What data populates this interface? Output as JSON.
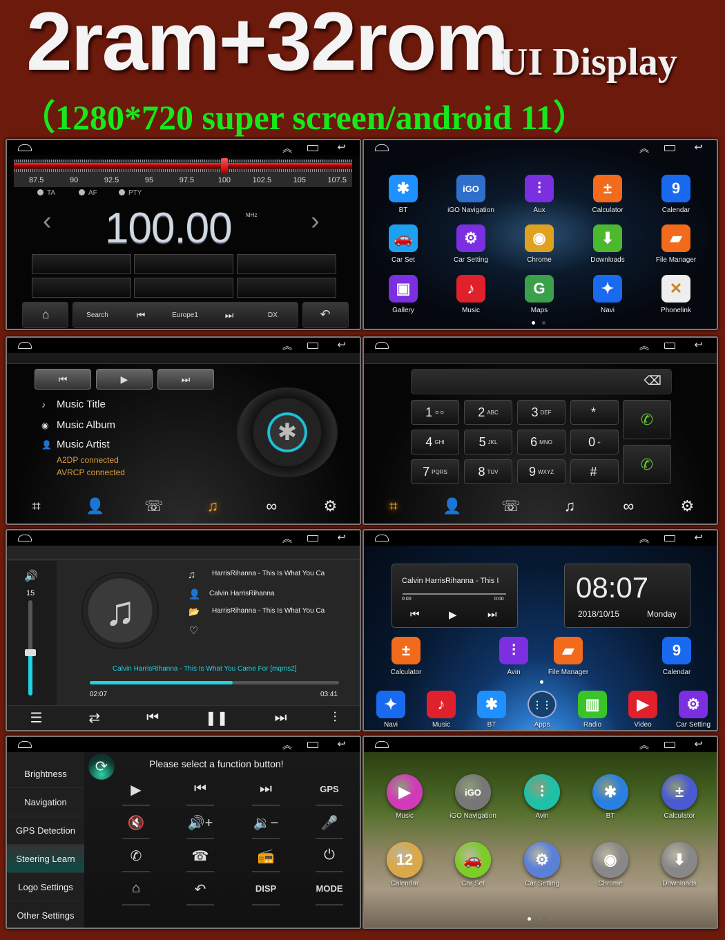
{
  "header": {
    "title": "2ram+32rom",
    "subtitle": "UI Display",
    "spec": "（1280*720 super screen/android 11）",
    "colors": {
      "background": "#6b1a0c",
      "spec_text": "#17e81a"
    }
  },
  "status_bar": {
    "home_icon": "home-outline-icon",
    "up_icon": "double-chevron-up-icon",
    "recent_icon": "recent-apps-icon",
    "back_icon": "back-arrow-icon",
    "up_glyph": "︽",
    "back_glyph": "↩"
  },
  "radio": {
    "scale_labels": [
      "87.5",
      "90",
      "92.5",
      "95",
      "97.5",
      "100",
      "102.5",
      "105",
      "107.5"
    ],
    "scale_range": [
      86,
      108.5
    ],
    "tuned": 100,
    "options": [
      "TA",
      "AF",
      "PTY"
    ],
    "frequency": "100.00",
    "unit": "MHz",
    "prev_glyph": "‹",
    "next_glyph": "›",
    "presets": [
      "",
      "",
      "",
      "",
      "",
      ""
    ],
    "toolbar": {
      "home": "⌂",
      "search": "Search",
      "prev": "⏮",
      "station": "Europe1",
      "next": "⏭",
      "dx": "DX",
      "back": "↶"
    }
  },
  "app_grid": {
    "apps": [
      {
        "name": "BT",
        "glyph": "✱",
        "color": "#1e90ff"
      },
      {
        "name": "iGO Navigation",
        "glyph": "iGO",
        "color": "#2f6fcc"
      },
      {
        "name": "Aux",
        "glyph": "⫶",
        "color": "#7b2fe0"
      },
      {
        "name": "Calculator",
        "glyph": "±",
        "color": "#f26a1b"
      },
      {
        "name": "Calendar",
        "glyph": "9",
        "color": "#1a6af0"
      },
      {
        "name": "Car Set",
        "glyph": "🚗",
        "color": "#1ea0f0"
      },
      {
        "name": "Car Setting",
        "glyph": "⚙",
        "color": "#7b2fe0"
      },
      {
        "name": "Chrome",
        "glyph": "◉",
        "color": "#e0a020"
      },
      {
        "name": "Downloads",
        "glyph": "⬇",
        "color": "#4cb82e"
      },
      {
        "name": "File Manager",
        "glyph": "▰",
        "color": "#f26a1b"
      },
      {
        "name": "Gallery",
        "glyph": "▣",
        "color": "#7b2fe0"
      },
      {
        "name": "Music",
        "glyph": "♪",
        "color": "#e0202a"
      },
      {
        "name": "Maps",
        "glyph": "G",
        "color": "#3aa04a"
      },
      {
        "name": "Navi",
        "glyph": "✦",
        "color": "#1a6af0"
      },
      {
        "name": "Phonelink",
        "glyph": "✕",
        "color": "#eeeeee"
      }
    ],
    "page_dots": 2,
    "active_page": 1
  },
  "bt_music": {
    "controls": [
      "⏮",
      "▶",
      "⏭"
    ],
    "title": "Music Title",
    "album": "Music Album",
    "artist": "Music Artist",
    "status": [
      "A2DP connected",
      "AVRCP connected"
    ],
    "tabs": [
      "dialpad",
      "contacts",
      "call-log",
      "music",
      "link",
      "settings"
    ],
    "tab_glyphs": [
      "⌗",
      "👤",
      "☏",
      "♫",
      "∞",
      "⚙"
    ],
    "active_tab": 3
  },
  "bt_dial": {
    "keys": [
      {
        "d": "1",
        "s": "ㅇㅇ"
      },
      {
        "d": "2",
        "s": "ABC"
      },
      {
        "d": "3",
        "s": "DEF"
      },
      {
        "d": "*",
        "s": ""
      },
      {
        "d": "4",
        "s": "GHI"
      },
      {
        "d": "5",
        "s": "JKL"
      },
      {
        "d": "6",
        "s": "MNO"
      },
      {
        "d": "0",
        "s": "+"
      },
      {
        "d": "7",
        "s": "PQRS"
      },
      {
        "d": "8",
        "s": "TUV"
      },
      {
        "d": "9",
        "s": "WXYZ"
      },
      {
        "d": "#",
        "s": ""
      }
    ],
    "call_glyph": "✆",
    "redial_glyph": "✆",
    "delete_glyph": "⌫",
    "number": "",
    "active_tab": 0
  },
  "music_player": {
    "volume": 15,
    "volume_fraction": 0.45,
    "track": "HarrisRihanna - This Is What You Ca",
    "artist": "Calvin HarrisRihanna",
    "folder": "HarrisRihanna - This Is What You Ca",
    "now_playing": "Calvin HarrisRihanna - This Is What You Came For [mqms2]",
    "elapsed": "02:07",
    "duration": "03:41",
    "progress": 0.574,
    "controls": [
      "☰",
      "⇄",
      "⏮",
      "❚❚",
      "⏭",
      "⫶"
    ],
    "accent": "#1fd3e0"
  },
  "home_screen": {
    "widget_track": "Calvin HarrisRihanna - This I",
    "widget_start": "0:00",
    "widget_end": "0:00",
    "clock": "08:07",
    "date": "2018/10/15",
    "weekday": "Monday",
    "apps": [
      {
        "name": "Calculator",
        "glyph": "±",
        "color": "#f26a1b"
      },
      {
        "name": "Avin",
        "glyph": "⫶",
        "color": "#7b2fe0"
      },
      {
        "name": "File Manager",
        "glyph": "▰",
        "color": "#f26a1b"
      },
      {
        "name": "Calendar",
        "glyph": "9",
        "color": "#1a6af0"
      }
    ],
    "dock": [
      {
        "name": "Navi",
        "glyph": "✦",
        "color": "#1a6af0"
      },
      {
        "name": "Music",
        "glyph": "♪",
        "color": "#e0202a"
      },
      {
        "name": "BT",
        "glyph": "✱",
        "color": "#1e90ff"
      },
      {
        "name": "Apps",
        "glyph": "⋮⋮",
        "color": "#14406e"
      },
      {
        "name": "Radio",
        "glyph": "▥",
        "color": "#3ac42a"
      },
      {
        "name": "Video",
        "glyph": "▶",
        "color": "#e0202a"
      },
      {
        "name": "Car Setting",
        "glyph": "⚙",
        "color": "#7b2fe0"
      }
    ]
  },
  "steering": {
    "menu": [
      "Brightness",
      "Navigation",
      "GPS Detection",
      "Steering Learn",
      "Logo Settings",
      "Other Settings"
    ],
    "active_menu": 3,
    "prompt": "Please select a function button!",
    "refresh_glyph": "⟳",
    "buttons": [
      {
        "g": "▶",
        "t": false
      },
      {
        "g": "⏮",
        "t": false
      },
      {
        "g": "⏭",
        "t": false
      },
      {
        "g": "GPS",
        "t": true
      },
      {
        "g": "🔇",
        "t": false
      },
      {
        "g": "🔊+",
        "t": false
      },
      {
        "g": "🔉−",
        "t": false
      },
      {
        "g": "🎤",
        "t": false
      },
      {
        "g": "✆",
        "t": false
      },
      {
        "g": "☎",
        "t": false
      },
      {
        "g": "📻",
        "t": false
      },
      {
        "g": "⏻",
        "t": false
      },
      {
        "g": "⌂",
        "t": false
      },
      {
        "g": "↶",
        "t": false
      },
      {
        "g": "DISP",
        "t": true
      },
      {
        "g": "MODE",
        "t": true
      }
    ]
  },
  "round_launcher": {
    "apps": [
      {
        "name": "Music",
        "glyph": "▶",
        "color": "#d23ab8"
      },
      {
        "name": "iGO Navigation",
        "glyph": "iGO",
        "color": "#777777"
      },
      {
        "name": "Avin",
        "glyph": "⫶",
        "color": "#20c0a8"
      },
      {
        "name": "BT",
        "glyph": "✱",
        "color": "#2a80e0"
      },
      {
        "name": "Calculator",
        "glyph": "±",
        "color": "#4a5ad0"
      },
      {
        "name": "Calendar",
        "glyph": "12",
        "color": "#d8a84a"
      },
      {
        "name": "Car Set",
        "glyph": "🚗",
        "color": "#7ccc2a"
      },
      {
        "name": "Car Setting",
        "glyph": "⚙",
        "color": "#5a80d8"
      },
      {
        "name": "Chrome",
        "glyph": "◉",
        "color": "#888888"
      },
      {
        "name": "Downloads",
        "glyph": "⬇",
        "color": "#888888"
      }
    ],
    "page_dots": 3,
    "active_page": 1
  }
}
